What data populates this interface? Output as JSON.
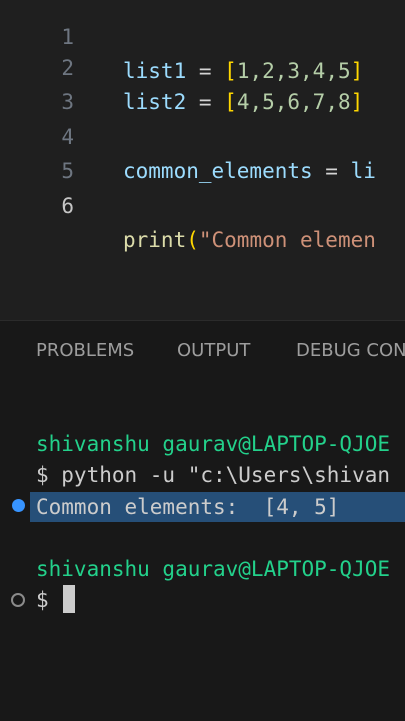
{
  "editor": {
    "lines": [
      {
        "number": "1",
        "tokens": [
          "list1",
          " = ",
          "[",
          "1,2,3,4,5",
          "]"
        ]
      },
      {
        "number": "2",
        "tokens": [
          "list2",
          " = ",
          "[",
          "4,5,6,7,8",
          "]"
        ]
      },
      {
        "number": "3"
      },
      {
        "number": "4",
        "tokens": [
          "common_elements",
          " = ",
          "li"
        ]
      },
      {
        "number": "5"
      },
      {
        "number": "6",
        "tokens": [
          "print",
          "(",
          "\"Common elemen"
        ]
      }
    ]
  },
  "panel": {
    "tabs": [
      "PROBLEMS",
      "OUTPUT",
      "DEBUG CON"
    ]
  },
  "terminal": {
    "prompt_user_1": "shivanshu gaurav@LAPTOP-QJOE",
    "command": "$ python -u \"c:\\Users\\shivan",
    "output": "Common elements:  [4, 5]",
    "prompt_user_2": "shivanshu gaurav@LAPTOP-QJOE",
    "prompt_symbol": "$"
  },
  "colors": {
    "accent": "#3794ff",
    "selection": "#264f78",
    "prompt_green": "#23d18b"
  }
}
